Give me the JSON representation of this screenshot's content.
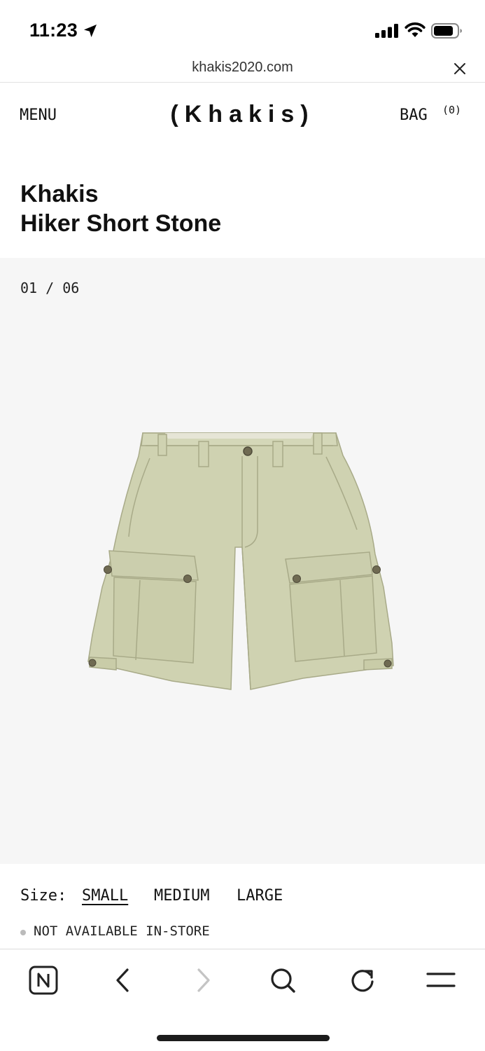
{
  "status_bar": {
    "time": "11:23"
  },
  "browser": {
    "url": "khakis2020.com"
  },
  "header": {
    "menu_label": "MENU",
    "logo": "(Khakis)",
    "bag_label": "BAG",
    "bag_count": "(0)"
  },
  "product": {
    "brand": "Khakis",
    "name": "Hiker Short Stone"
  },
  "gallery": {
    "counter": "01 / 06"
  },
  "sizes": {
    "label": "Size:",
    "options": [
      "SMALL",
      "MEDIUM",
      "LARGE"
    ],
    "selected": "SMALL"
  },
  "availability": {
    "text": "NOT AVAILABLE IN-STORE"
  },
  "colors": {
    "product_fill": "#cfd2b1",
    "gallery_background": "#f6f6f6",
    "text": "#111111"
  },
  "icons": {
    "status": [
      "location-arrow-icon",
      "signal-icon",
      "wifi-icon",
      "battery-icon"
    ],
    "toolbar": [
      "n-logo-icon",
      "back-arrow-icon",
      "forward-arrow-icon",
      "search-icon",
      "reload-icon",
      "menu-icon"
    ]
  }
}
